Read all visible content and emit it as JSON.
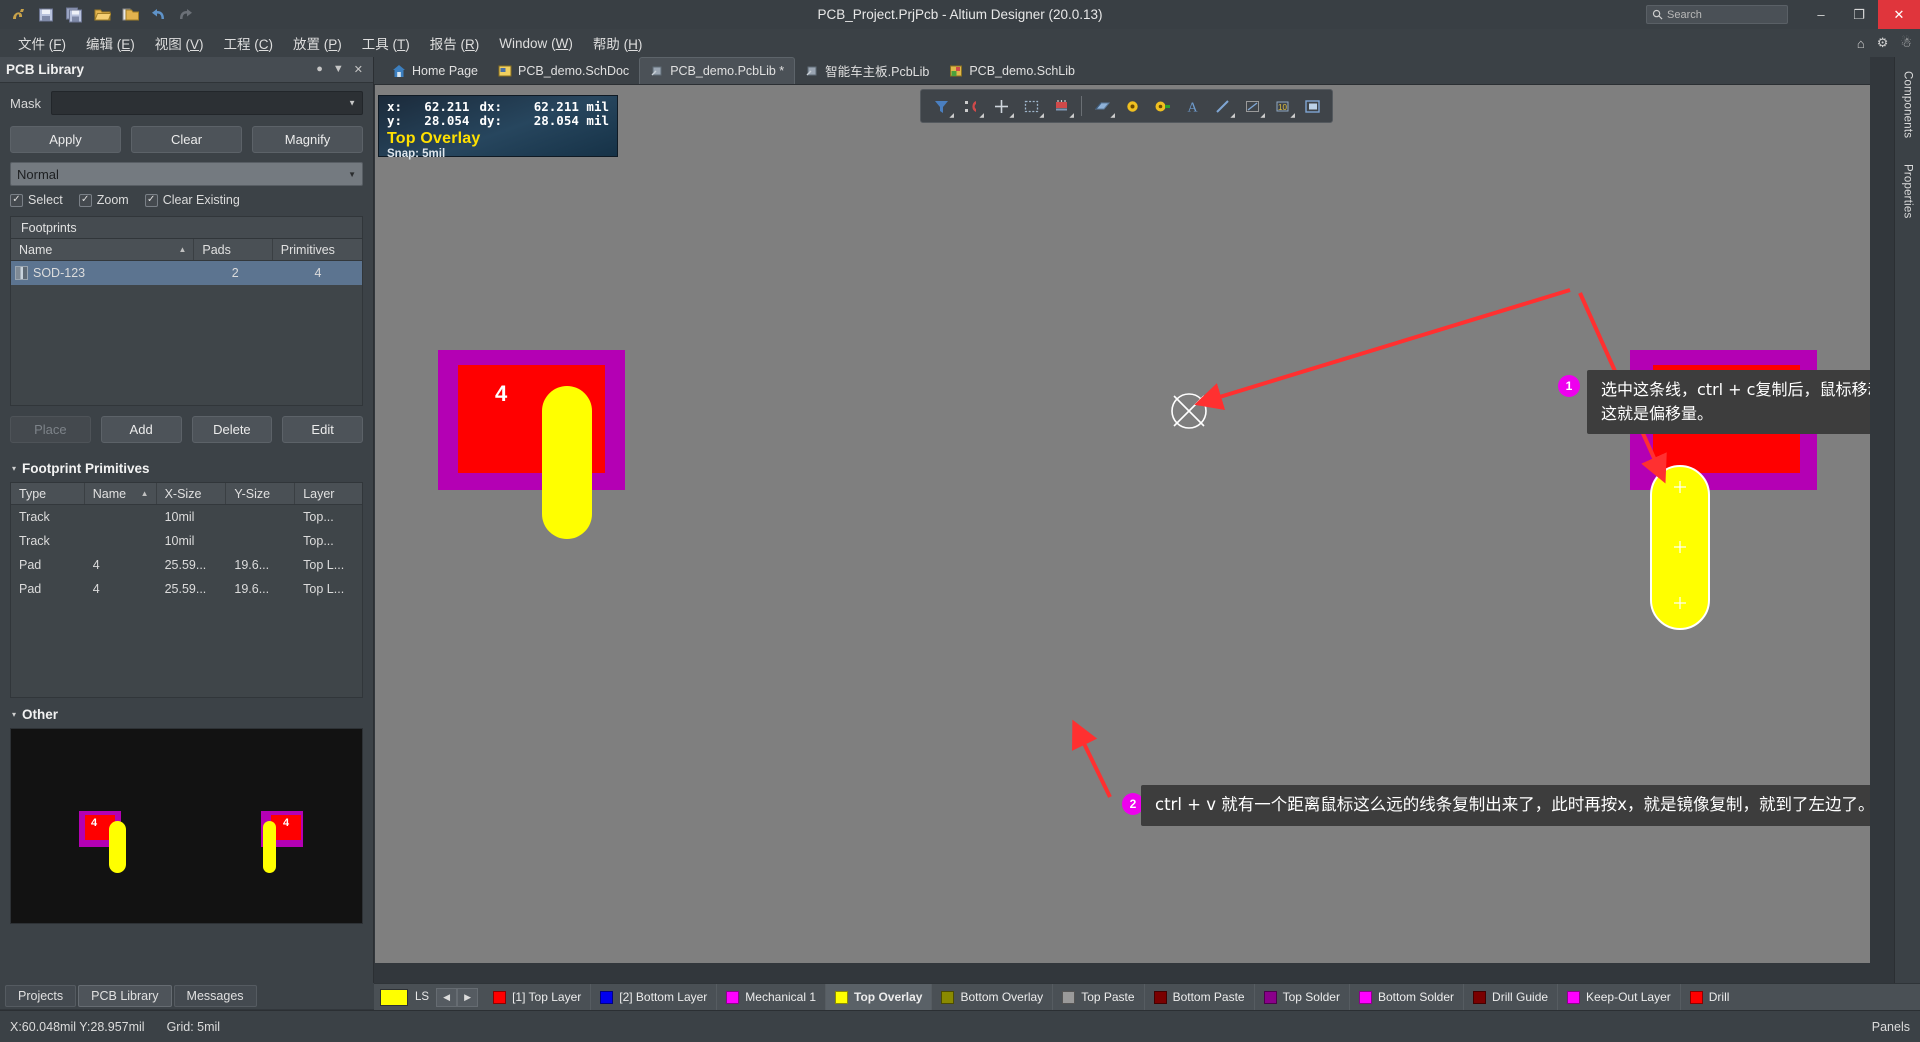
{
  "window": {
    "title": "PCB_Project.PrjPcb - Altium Designer (20.0.13)",
    "quick_icons": [
      "altium-logo-icon",
      "save-icon",
      "save-all-icon",
      "open-folder-icon",
      "open-project-icon",
      "undo-icon",
      "redo-icon"
    ],
    "search_placeholder": "Search",
    "minimize_label": "–",
    "maximize_label": "❐",
    "close_label": "✕"
  },
  "menubar": {
    "items": [
      {
        "label": "文件",
        "accel": "F"
      },
      {
        "label": "编辑",
        "accel": "E"
      },
      {
        "label": "视图",
        "accel": "V"
      },
      {
        "label": "工程",
        "accel": "C"
      },
      {
        "label": "放置",
        "accel": "P"
      },
      {
        "label": "工具",
        "accel": "T"
      },
      {
        "label": "报告",
        "accel": "R"
      },
      {
        "label": "Window",
        "accel": "W"
      },
      {
        "label": "帮助",
        "accel": "H"
      }
    ],
    "right_icons": [
      "home-icon",
      "gear-icon",
      "user-icon"
    ]
  },
  "panel": {
    "title": "PCB Library",
    "header_icons": [
      "pin-icon",
      "minimize-panel-icon",
      "close-panel-icon"
    ],
    "mask_label": "Mask",
    "mask_value": "",
    "buttons": {
      "apply": "Apply",
      "clear": "Clear",
      "magnify": "Magnify"
    },
    "mode_value": "Normal",
    "checks": [
      {
        "label": "Select",
        "checked": true
      },
      {
        "label": "Zoom",
        "checked": true
      },
      {
        "label": "Clear Existing",
        "checked": true
      }
    ],
    "footprints": {
      "group_label": "Footprints",
      "columns": [
        "Name",
        "Pads",
        "Primitives"
      ],
      "sort_column": "Name",
      "rows": [
        {
          "name": "SOD-123",
          "pads": "2",
          "primitives": "4",
          "selected": true
        }
      ]
    },
    "list_buttons": {
      "place": "Place",
      "add": "Add",
      "delete": "Delete",
      "edit": "Edit"
    },
    "primitives": {
      "section_label": "Footprint Primitives",
      "columns": [
        "Type",
        "Name",
        "X-Size",
        "Y-Size",
        "Layer"
      ],
      "sort_column": "Name",
      "rows": [
        {
          "type": "Track",
          "name": "",
          "xsize": "10mil",
          "ysize": "",
          "layer": "Top..."
        },
        {
          "type": "Track",
          "name": "",
          "xsize": "10mil",
          "ysize": "",
          "layer": "Top..."
        },
        {
          "type": "Pad",
          "name": "4",
          "xsize": "25.59...",
          "ysize": "19.6...",
          "layer": "Top L..."
        },
        {
          "type": "Pad",
          "name": "4",
          "xsize": "25.59...",
          "ysize": "19.6...",
          "layer": "Top L..."
        }
      ]
    },
    "other": {
      "section_label": "Other"
    }
  },
  "doctabs": [
    {
      "label": "Home Page",
      "icon": "home-icon",
      "active": false,
      "modified": false
    },
    {
      "label": "PCB_demo.SchDoc",
      "icon": "schdoc-icon",
      "active": false,
      "modified": false
    },
    {
      "label": "PCB_demo.PcbLib *",
      "icon": "pcblib-icon",
      "active": true,
      "modified": true
    },
    {
      "label": "智能车主板.PcbLib",
      "icon": "pcblib-icon",
      "active": false,
      "modified": false
    },
    {
      "label": "PCB_demo.SchLib",
      "icon": "schlib-icon",
      "active": false,
      "modified": false
    }
  ],
  "canvas": {
    "coord_readout": {
      "x_key": "x:",
      "x_value": "62.211",
      "y_key": "y:",
      "y_value": "28.054",
      "dx_key": "dx:",
      "dx_value": "62.211 mil",
      "dy_key": "dy:",
      "dy_value": "28.054 mil",
      "layer": "Top Overlay",
      "snap": "Snap: 5mil"
    },
    "toolbar_icons": [
      "filter-icon",
      "magnet-icon",
      "crosshair-icon",
      "select-area-icon",
      "place-component-icon",
      "place-track-icon",
      "place-via-icon",
      "place-pad-icon",
      "place-text-icon",
      "place-line-icon",
      "place-polygon-icon",
      "place-dimension-icon",
      "place-fill-icon"
    ],
    "callouts": [
      {
        "number": "1",
        "lines": [
          "选中这条线，ctrl + c复制后，鼠标移动到中心点，点击左键。",
          "这就是偏移量。"
        ]
      },
      {
        "number": "2",
        "lines": [
          "ctrl + v 就有一个距离鼠标这么远的线条复制出来了，此时再按x，就是镜像复制，就到了左边了。"
        ]
      }
    ],
    "pad_labels": [
      "4",
      "4"
    ],
    "colors": {
      "background": "#7f7f7f",
      "purple": "#b400b4",
      "red": "#ff0000",
      "yellow": "#ffff00",
      "arrow": "#ff3030",
      "bubble": "#ee00ee"
    }
  },
  "panel_tabs": [
    {
      "label": "Projects",
      "active": false
    },
    {
      "label": "PCB Library",
      "active": true
    },
    {
      "label": "Messages",
      "active": false
    }
  ],
  "layerbar": {
    "ls_label": "LS",
    "ls_color": "#ffff00",
    "prev_label": "◀",
    "next_label": "▶",
    "layers": [
      {
        "label": "[1] Top Layer",
        "color": "#ff0000",
        "active": false
      },
      {
        "label": "[2] Bottom Layer",
        "color": "#0000ee",
        "active": false
      },
      {
        "label": "Mechanical 1",
        "color": "#ff00ff",
        "active": false
      },
      {
        "label": "Top Overlay",
        "color": "#ffff00",
        "active": true
      },
      {
        "label": "Bottom Overlay",
        "color": "#8a8a00",
        "active": false
      },
      {
        "label": "Top Paste",
        "color": "#9a9a9a",
        "active": false
      },
      {
        "label": "Bottom Paste",
        "color": "#7a0000",
        "active": false
      },
      {
        "label": "Top Solder",
        "color": "#8a008a",
        "active": false
      },
      {
        "label": "Bottom Solder",
        "color": "#ff00ff",
        "active": false
      },
      {
        "label": "Drill Guide",
        "color": "#7a0000",
        "active": false
      },
      {
        "label": "Keep-Out Layer",
        "color": "#ff00ff",
        "active": false
      },
      {
        "label": "Drill",
        "color": "#ff0000",
        "active": false
      }
    ]
  },
  "statusbar": {
    "coords": "X:60.048mil Y:28.957mil",
    "grid": "Grid: 5mil",
    "panels_label": "Panels"
  },
  "rightdock": {
    "tabs": [
      "Components",
      "Properties"
    ]
  }
}
